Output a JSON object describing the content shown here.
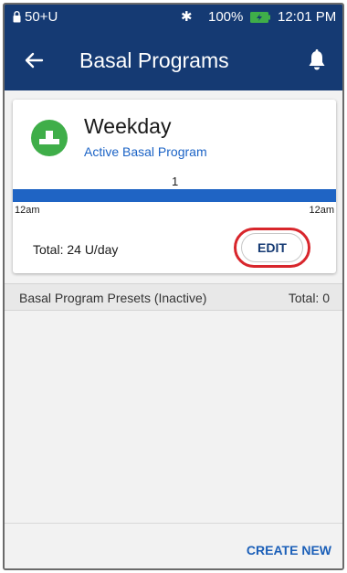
{
  "status_bar": {
    "units": "50+U",
    "battery_percent": "100%",
    "time": "12:01 PM",
    "icons": [
      "lock-icon",
      "bluetooth-icon",
      "battery-icon"
    ]
  },
  "header": {
    "title": "Basal Programs",
    "icons": [
      "back-arrow-icon",
      "bell-icon"
    ]
  },
  "active_program": {
    "name": "Weekday",
    "status": "Active Basal Program",
    "rate_label": "1",
    "time_start": "12am",
    "time_end": "12am",
    "total": "Total: 24 U/day",
    "edit_label": "EDIT",
    "icon": "basal-program-icon"
  },
  "presets": {
    "label": "Basal Program Presets (Inactive)",
    "total": "Total: 0"
  },
  "footer": {
    "create_label": "CREATE NEW"
  },
  "colors": {
    "header_bg": "#153a73",
    "accent_blue": "#1f64c4",
    "program_green": "#3fae49",
    "highlight_red": "#d8262c"
  }
}
